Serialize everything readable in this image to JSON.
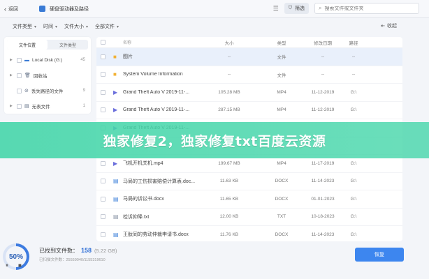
{
  "topbar": {
    "back_label": "返回",
    "title": "硬盘驱动器及路径",
    "filter_label": "筛选",
    "search_placeholder": "搜索文件或文件夹"
  },
  "filterbar": {
    "dropdowns": [
      "文件类型",
      "时间",
      "文件大小",
      "全部文件"
    ],
    "collapse_label": "收起"
  },
  "sidebar": {
    "tabs": [
      "文件位置",
      "文件类型"
    ],
    "items": [
      {
        "label": "Local Disk (G:)",
        "count": "45"
      },
      {
        "label": "回收站",
        "count": ""
      },
      {
        "label": "丢失路径的文件",
        "count": "9"
      },
      {
        "label": "无表文件",
        "count": "1"
      }
    ]
  },
  "list": {
    "head": {
      "name": "名称",
      "size": "大小",
      "type": "类型",
      "date": "修改日期",
      "path": "路径"
    },
    "rows": [
      {
        "icon": "folder",
        "name": "图片",
        "size": "--",
        "type": "文件",
        "date": "--",
        "path": "--",
        "hl": true
      },
      {
        "icon": "folder",
        "name": "System Volume Information",
        "size": "--",
        "type": "文件",
        "date": "--",
        "path": "--",
        "hl": false
      },
      {
        "icon": "video",
        "name": "Grand Theft Auto V 2019-11-...",
        "size": "105.28 MB",
        "type": "MP4",
        "date": "11-12-2019",
        "path": "G:\\",
        "hl": false
      },
      {
        "icon": "video",
        "name": "Grand Theft Auto V 2019-11-...",
        "size": "287.15 MB",
        "type": "MP4",
        "date": "11-12-2019",
        "path": "G:\\",
        "hl": false
      },
      {
        "icon": "video",
        "name": "Grand Theft Auto V 2019-11-...",
        "size": "",
        "type": "",
        "date": "",
        "path": "",
        "hl": false
      },
      {
        "icon": "video",
        "name": "",
        "size": "",
        "type": "",
        "date": "",
        "path": "",
        "hl": false
      },
      {
        "icon": "video",
        "name": "飞机开机关机.mp4",
        "size": "199.67 MB",
        "type": "MP4",
        "date": "11-17-2019",
        "path": "G:\\",
        "hl": false
      },
      {
        "icon": "doc",
        "name": "马局的工伤损害赔偿计算表.doc...",
        "size": "11.63 KB",
        "type": "DOCX",
        "date": "11-14-2023",
        "path": "G:\\",
        "hl": false
      },
      {
        "icon": "doc",
        "name": "马局的诉讼书.docx",
        "size": "11.65 KB",
        "type": "DOCX",
        "date": "01-01-2023",
        "path": "G:\\",
        "hl": false
      },
      {
        "icon": "txt",
        "name": "检诉抑降.txt",
        "size": "12.00 KB",
        "type": "TXT",
        "date": "10-18-2023",
        "path": "G:\\",
        "hl": false
      },
      {
        "icon": "doc",
        "name": "王肽同的劳动仲裁申请书.docx",
        "size": "11.76 KB",
        "type": "DOCX",
        "date": "11-14-2023",
        "path": "G:\\",
        "hl": false
      }
    ]
  },
  "footer": {
    "progress_percent": 50,
    "progress_label": "50%",
    "found_label": "已找到文件数：",
    "found_count": "158",
    "found_size": "(5.22 GB)",
    "scanned_text": "已扫描文件数：25559040/1155319610",
    "recover_label": "恢复"
  },
  "banner": {
    "text": "独家修复2，独家修复txt百度云资源"
  },
  "colors": {
    "accent": "#3d86ef",
    "banner": "#46d6aa",
    "folder": "#f2b134"
  }
}
